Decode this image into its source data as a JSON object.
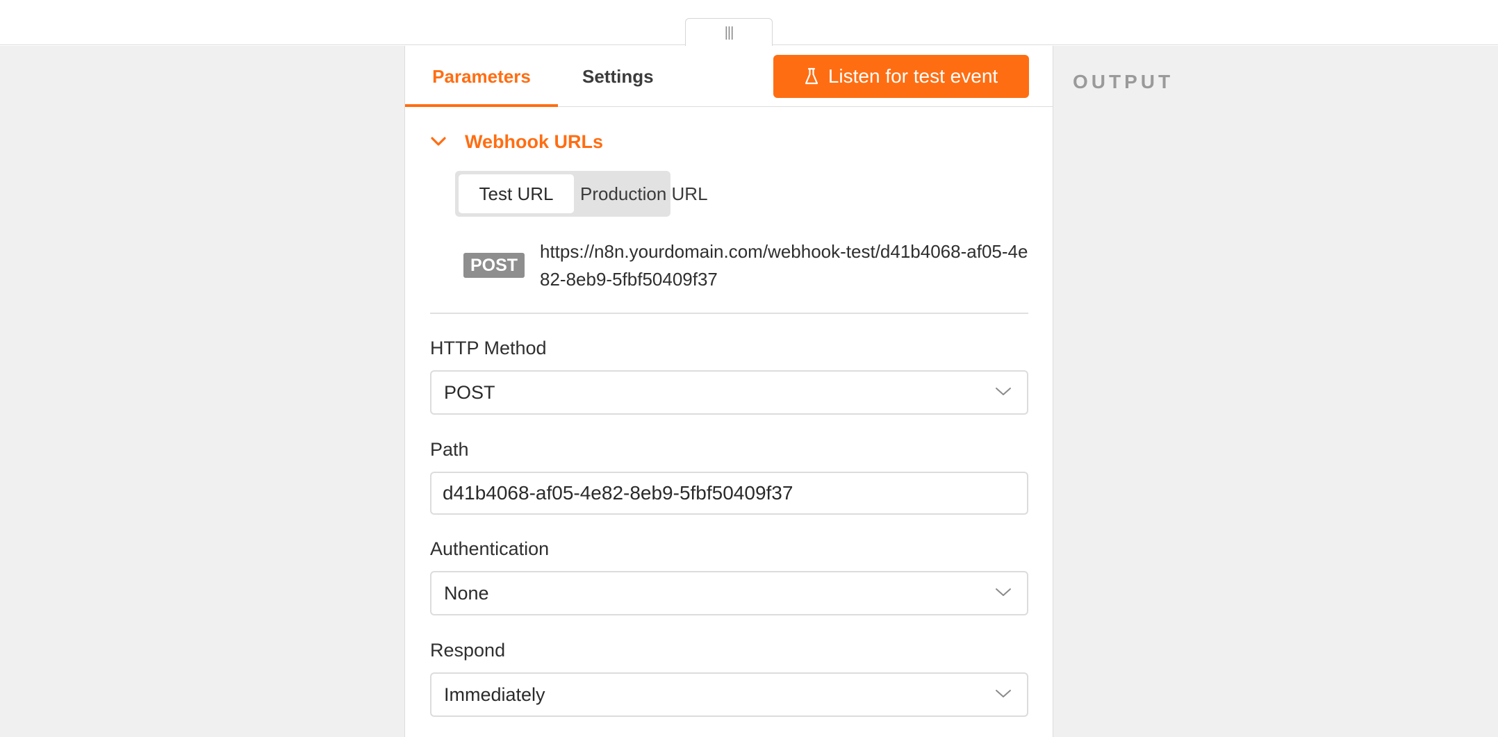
{
  "drag_handle": {
    "glyph": "|||",
    "icon": "drag-handle-icon"
  },
  "tabs": [
    {
      "label": "Parameters",
      "active": true
    },
    {
      "label": "Settings",
      "active": false
    }
  ],
  "listen_button": {
    "label": "Listen for test event",
    "icon": "flask-icon"
  },
  "output": {
    "label": "OUTPUT"
  },
  "webhook_section": {
    "title": "Webhook URLs",
    "expanded": true,
    "url_toggle": {
      "options": [
        "Test URL",
        "Production URL"
      ],
      "selected": "Test URL"
    },
    "method_badge": "POST",
    "url": "https://n8n.yourdomain.com/webhook-test/d41b4068-af05-4e82-8eb9-5fbf50409f37"
  },
  "fields": {
    "http_method": {
      "label": "HTTP Method",
      "value": "POST"
    },
    "path": {
      "label": "Path",
      "value": "d41b4068-af05-4e82-8eb9-5fbf50409f37"
    },
    "authentication": {
      "label": "Authentication",
      "value": "None"
    },
    "respond": {
      "label": "Respond",
      "value": "Immediately"
    }
  },
  "colors": {
    "accent": "#ff6d12",
    "badge": "#8e8e8e",
    "background_gray": "#f0f0f0"
  }
}
